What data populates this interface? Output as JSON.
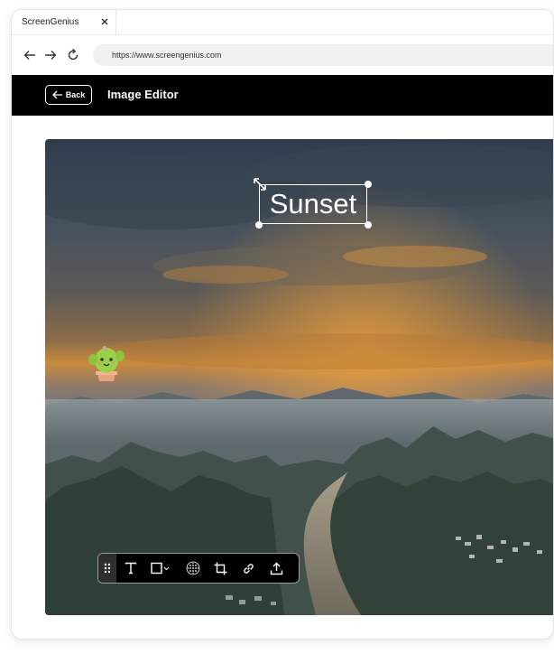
{
  "browser": {
    "tab_title": "ScreenGenius",
    "url": "https://www.screengenius.com"
  },
  "app": {
    "back_label": "Back",
    "title": "Image Editor"
  },
  "canvas": {
    "text_overlay": "Sunset"
  },
  "toolbar": {
    "tools": [
      "drag-handle",
      "text-tool",
      "shape-tool",
      "blur-tool",
      "crop-tool",
      "link-tool",
      "upload-tool"
    ]
  },
  "colors": {
    "header_bg": "#000000",
    "accent": "#ffffff"
  }
}
